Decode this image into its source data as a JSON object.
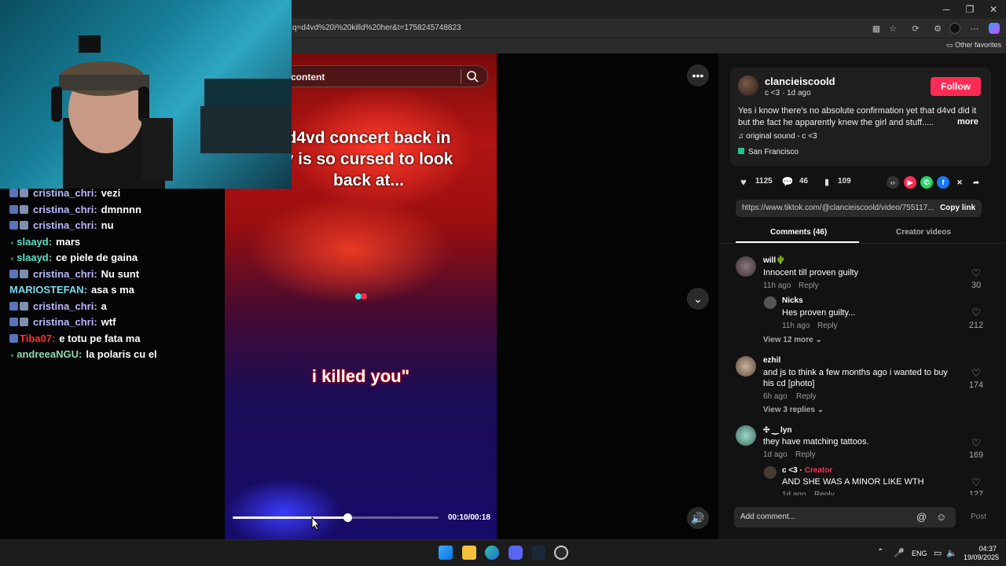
{
  "browser": {
    "url": "q=d4vd%20i%20killd%20her&t=1758245748823",
    "favorites_label": "Other favorites",
    "window_controls": [
      "─",
      "❐",
      "✕"
    ]
  },
  "video": {
    "search_placeholder": "content",
    "caption": "d4vd concert back in y is so cursed to look back at...",
    "overlay_text": "i killed you\"",
    "time": "00:10/00:18",
    "progress": 0.56
  },
  "chat": {
    "messages": [
      {
        "user": "cristina_chri:",
        "text": "vezi",
        "color": "#b9b9ff",
        "badges": 2
      },
      {
        "user": "cristina_chri:",
        "text": "dmnnnn",
        "color": "#b9b9ff",
        "badges": 2
      },
      {
        "user": "cristina_chri:",
        "text": "nu",
        "color": "#b9b9ff",
        "badges": 2
      },
      {
        "user": "slaayd:",
        "text": "mars",
        "color": "#5ee0c8",
        "badges": 0
      },
      {
        "user": "slaayd:",
        "text": "ce piele de gaina",
        "color": "#5ee0c8",
        "badges": 0
      },
      {
        "user": "cristina_chri:",
        "text": "Nu sunt",
        "color": "#b9b9ff",
        "badges": 2
      },
      {
        "user": "MARIOSTEFAN:",
        "text": "asa s ma",
        "color": "#7dd9e8",
        "badges": 0
      },
      {
        "user": "cristina_chri:",
        "text": "a",
        "color": "#b9b9ff",
        "badges": 2
      },
      {
        "user": "cristina_chri:",
        "text": "wtf",
        "color": "#b9b9ff",
        "badges": 2
      },
      {
        "user": "Tiba07:",
        "text": "e totu pe fata ma",
        "color": "#ff3030",
        "badges": 1
      },
      {
        "user": "andreeaNGU:",
        "text": "la polaris cu el",
        "color": "#8fd9b0",
        "badges": 0
      }
    ]
  },
  "post": {
    "username": "clancieiscoold",
    "meta": "c <3 · 1d ago",
    "follow_label": "Follow",
    "description": "Yes i know there's no absolute confirmation yet that d4vd did it but the fact he apparently knew the girl and stuff.....",
    "more_label": "more",
    "sound": "original sound - c <3",
    "location": "San Francisco",
    "likes": "1125",
    "comments": "46",
    "saves": "109",
    "link": "https://www.tiktok.com/@clancieiscoold/video/755117...",
    "copy_label": "Copy link"
  },
  "tabs": {
    "comments": "Comments (46)",
    "creator": "Creator videos"
  },
  "comments": [
    {
      "name": "will🌵",
      "text": "Innocent till proven guilty",
      "time": "11h ago",
      "reply": "Reply",
      "likes": "30"
    },
    {
      "name": "Nicks",
      "text": "Hes proven guilty...",
      "time": "11h ago",
      "reply": "Reply",
      "likes": "212"
    },
    {
      "view_more": "View 12 more"
    },
    {
      "name": "ezhil",
      "text": "and js to think a few months ago i wanted to buy his cd [photo]",
      "time": "6h ago",
      "reply": "Reply",
      "likes": "174"
    },
    {
      "view_more": "View 3 replies"
    },
    {
      "name": "✣ ‿ lyn",
      "text": "they have matching tattoos.",
      "time": "1d ago",
      "reply": "Reply",
      "likes": "169"
    },
    {
      "name": "c <3 ·",
      "creator_tag": "Creator",
      "text": "AND SHE WAS A MINOR LIKE WTH",
      "time": "1d ago",
      "reply": "Reply",
      "likes": "127"
    }
  ],
  "comment_bar": {
    "placeholder": "Add comment...",
    "post_label": "Post"
  },
  "taskbar": {
    "lang": "ENG",
    "time": "04:37",
    "date": "19/09/2025"
  },
  "colors": {
    "accent": "#fe2c55",
    "chat_user": "#b9b9ff"
  }
}
